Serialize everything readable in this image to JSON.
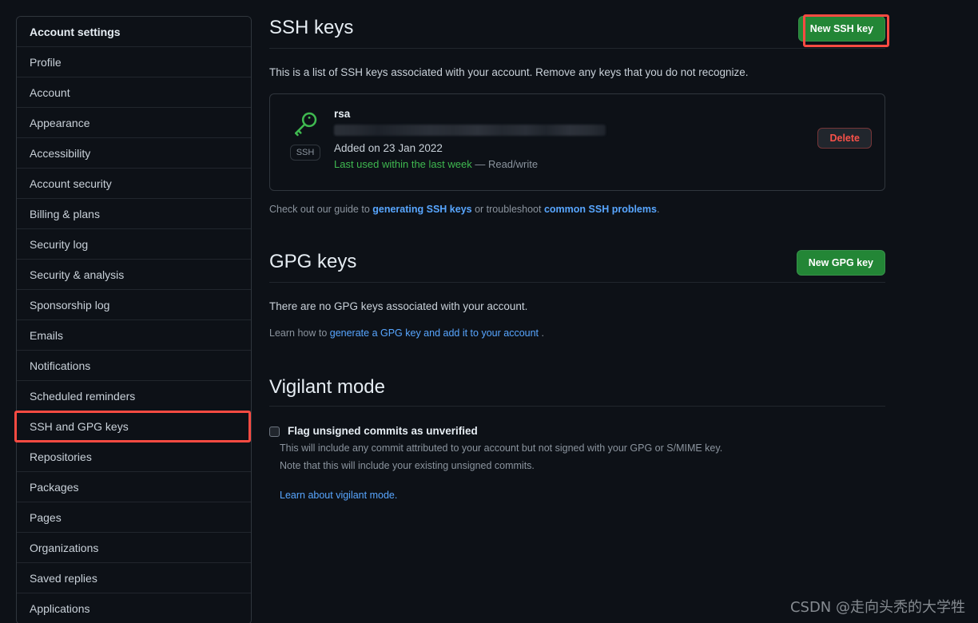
{
  "sidebar": {
    "items": [
      {
        "label": "Account settings",
        "heading": true
      },
      {
        "label": "Profile"
      },
      {
        "label": "Account"
      },
      {
        "label": "Appearance"
      },
      {
        "label": "Accessibility"
      },
      {
        "label": "Account security"
      },
      {
        "label": "Billing & plans"
      },
      {
        "label": "Security log"
      },
      {
        "label": "Security & analysis"
      },
      {
        "label": "Sponsorship log"
      },
      {
        "label": "Emails"
      },
      {
        "label": "Notifications"
      },
      {
        "label": "Scheduled reminders"
      },
      {
        "label": "SSH and GPG keys",
        "highlighted": true
      },
      {
        "label": "Repositories"
      },
      {
        "label": "Packages"
      },
      {
        "label": "Pages"
      },
      {
        "label": "Organizations"
      },
      {
        "label": "Saved replies"
      },
      {
        "label": "Applications"
      }
    ]
  },
  "ssh": {
    "title": "SSH keys",
    "new_button": "New SSH key",
    "intro": "This is a list of SSH keys associated with your account. Remove any keys that you do not recognize.",
    "key": {
      "icon_name": "key-icon",
      "badge": "SSH",
      "title": "rsa",
      "fingerprint_redacted": true,
      "added": "Added on 23 Jan 2022",
      "last_used": "Last used within the last week",
      "access": "— Read/write",
      "delete_button": "Delete"
    },
    "helper": {
      "prefix": "Check out our guide to ",
      "link1": "generating SSH keys",
      "middle": " or troubleshoot ",
      "link2": "common SSH problems",
      "suffix": "."
    }
  },
  "gpg": {
    "title": "GPG keys",
    "new_button": "New GPG key",
    "empty_text": "There are no GPG keys associated with your account.",
    "learn_prefix": "Learn how to ",
    "learn_link": "generate a GPG key and add it to your account",
    "learn_suffix": " ."
  },
  "vigilant": {
    "title": "Vigilant mode",
    "checkbox_label": "Flag unsigned commits as unverified",
    "checkbox_checked": false,
    "note_line1": "This will include any commit attributed to your account but not signed with your GPG or S/MIME key.",
    "note_line2": "Note that this will include your existing unsigned commits.",
    "learn_link": "Learn about vigilant mode."
  },
  "watermark": {
    "text": "CSDN @走向头秃的大学牲"
  },
  "colors": {
    "background": "#0d1117",
    "border": "#30363d",
    "text": "#c9d1d9",
    "text_strong": "#e6edf3",
    "muted": "#8b949e",
    "link": "#58a6ff",
    "green_button": "#238636",
    "green_text": "#3fb950",
    "danger": "#f85149",
    "annotation_red": "#fb4b42"
  }
}
